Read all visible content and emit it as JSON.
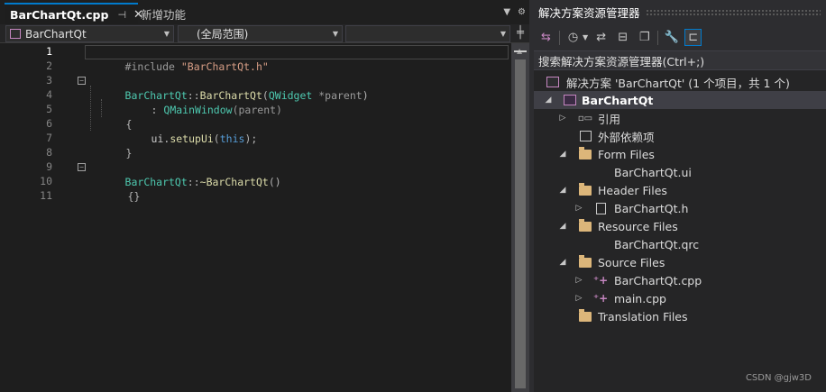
{
  "editor": {
    "active_tab": {
      "label": "BarChartQt.cpp",
      "pin_icon": "pin-icon",
      "close_icon": "close-icon"
    },
    "inactive_tab": {
      "label": "新增功能"
    },
    "nav": {
      "class_combo": "BarChartQt",
      "scope_combo": "(全局范围)",
      "member_combo": ""
    },
    "line_numbers": [
      "1",
      "2",
      "3",
      "4",
      "5",
      "6",
      "7",
      "8",
      "9",
      "10",
      "11"
    ],
    "code": {
      "l1_include": "#include ",
      "l1_str": "\"BarChartQt.h\"",
      "l3_cls": "BarChartQt",
      "l3_sep": "::",
      "l3_fn": "BarChartQt",
      "l3_open": "(",
      "l3_type": "QWidget",
      "l3_param": " *parent",
      "l3_close": ")",
      "l4_colon": ": ",
      "l4_base": "QMainWindow",
      "l4_args": "(parent)",
      "l5": "{",
      "l6_obj": "ui.",
      "l6_fn": "setupUi",
      "l6_open": "(",
      "l6_kw": "this",
      "l6_close": ");",
      "l7": "}",
      "l9_cls": "BarChartQt",
      "l9_sep": "::",
      "l9_fn": "~BarChartQt",
      "l9_parens": "()",
      "l10": "{}"
    }
  },
  "solution_explorer": {
    "title": "解决方案资源管理器",
    "search_placeholder": "搜索解决方案资源管理器(Ctrl+;)",
    "solution_label": "解决方案 'BarChartQt' (1 个项目，共 1 个)",
    "project_label": "BarChartQt",
    "references_label": "引用",
    "external_deps_label": "外部依赖项",
    "form_files_label": "Form Files",
    "form_file_1": "BarChartQt.ui",
    "header_files_label": "Header Files",
    "header_file_1": "BarChartQt.h",
    "resource_files_label": "Resource Files",
    "resource_file_1": "BarChartQt.qrc",
    "source_files_label": "Source Files",
    "source_file_1": "BarChartQt.cpp",
    "source_file_2": "main.cpp",
    "translation_files_label": "Translation Files"
  },
  "watermark": "CSDN @gjw3D",
  "colors": {
    "accent": "#007acc",
    "editor_bg": "#1e1e1e",
    "class_color": "#4ec9b0",
    "string_color": "#d69d85",
    "keyword_color": "#569cd6",
    "folder_color": "#dcb67a"
  }
}
